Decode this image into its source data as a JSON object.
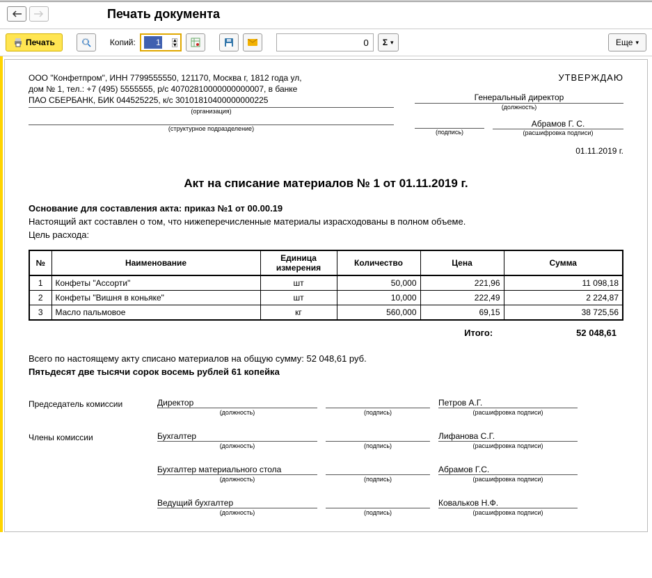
{
  "titlebar": {
    "title": "Печать документа"
  },
  "toolbar": {
    "print": "Печать",
    "copies_label": "Копий:",
    "copies_value": "1",
    "field_value": "0",
    "more": "Еще"
  },
  "header": {
    "approve": "УТВЕРЖДАЮ",
    "org_line1": "ООО \"Конфетпром\", ИНН 7799555550, 121170, Москва г, 1812 года ул,",
    "org_line2": "дом № 1, тел.: +7 (495) 5555555, р/с 40702810000000000007, в банке",
    "org_line3": "ПАО СБЕРБАНК, БИК 044525225, к/с 30101810400000000225",
    "org_sub": "(организация)",
    "dept_sub": "(структурное подразделение)",
    "position": "Генеральный директор",
    "position_sub": "(должность)",
    "sig_sub": "(подпись)",
    "name": "Абрамов Г. С.",
    "name_sub": "(расшифровка подписи)",
    "date": "01.11.2019 г."
  },
  "doc": {
    "title": "Акт на списание материалов № 1 от 01.11.2019 г.",
    "basis": "Основание для составления акта: приказ №1 от 00.00.19",
    "text": "Настоящий акт составлен о том, что нижеперечисленные материалы израсходованы в полном объеме.",
    "goal": "Цель расхода:"
  },
  "table": {
    "h_no": "№",
    "h_name": "Наименование",
    "h_unit": "Единица измерения",
    "h_qty": "Количество",
    "h_price": "Цена",
    "h_sum": "Сумма",
    "rows": [
      {
        "no": "1",
        "name": "Конфеты \"Ассорти\"",
        "unit": "шт",
        "qty": "50,000",
        "price": "221,96",
        "sum": "11 098,18"
      },
      {
        "no": "2",
        "name": "Конфеты \"Вишня в коньяке\"",
        "unit": "шт",
        "qty": "10,000",
        "price": "222,49",
        "sum": "2 224,87"
      },
      {
        "no": "3",
        "name": "Масло пальмовое",
        "unit": "кг",
        "qty": "560,000",
        "price": "69,15",
        "sum": "38 725,56"
      }
    ],
    "itogo_label": "Итого:",
    "itogo_value": "52 048,61"
  },
  "totals": {
    "line": "Всего по настоящему акту списано материалов на общую сумму: 52 048,61 руб.",
    "words": "Пятьдесят две тысячи сорок восемь рублей 61 копейка"
  },
  "signatures": {
    "chair_label": "Председатель комиссии",
    "members_label": "Члены комиссии",
    "pos_sub": "(должность)",
    "sig_sub": "(подпись)",
    "name_sub": "(расшифровка подписи)",
    "rows": [
      {
        "role_idx": 0,
        "pos": "Директор",
        "name": "Петров А.Г."
      },
      {
        "role_idx": 1,
        "pos": "Бухгалтер",
        "name": "Лифанова С.Г."
      },
      {
        "role_idx": 2,
        "pos": "Бухгалтер материального стола",
        "name": "Абрамов Г.С."
      },
      {
        "role_idx": 3,
        "pos": "Ведущий бухгалтер",
        "name": "Ковальков Н.Ф."
      }
    ]
  }
}
